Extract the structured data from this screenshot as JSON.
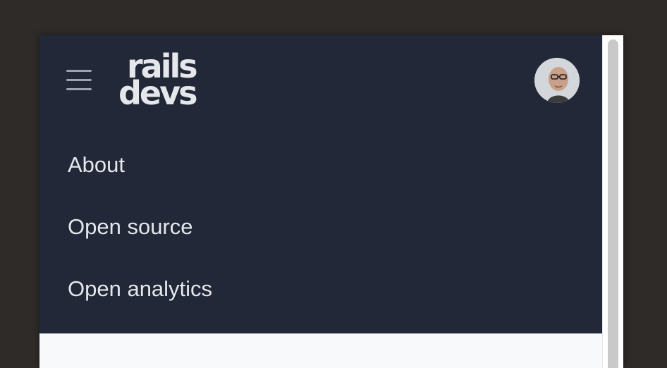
{
  "header": {
    "logo_line1": "rails",
    "logo_line2": "devs",
    "menu_icon": "hamburger-icon",
    "avatar_icon": "user-avatar"
  },
  "nav": {
    "items": [
      {
        "label": "About"
      },
      {
        "label": "Open source"
      },
      {
        "label": "Open analytics"
      }
    ]
  },
  "colors": {
    "nav_background": "#222837",
    "page_background": "#f8f9fb",
    "desktop_background": "#2e2b29",
    "nav_text": "#e5e7eb",
    "menu_icon": "#9ca3af"
  }
}
